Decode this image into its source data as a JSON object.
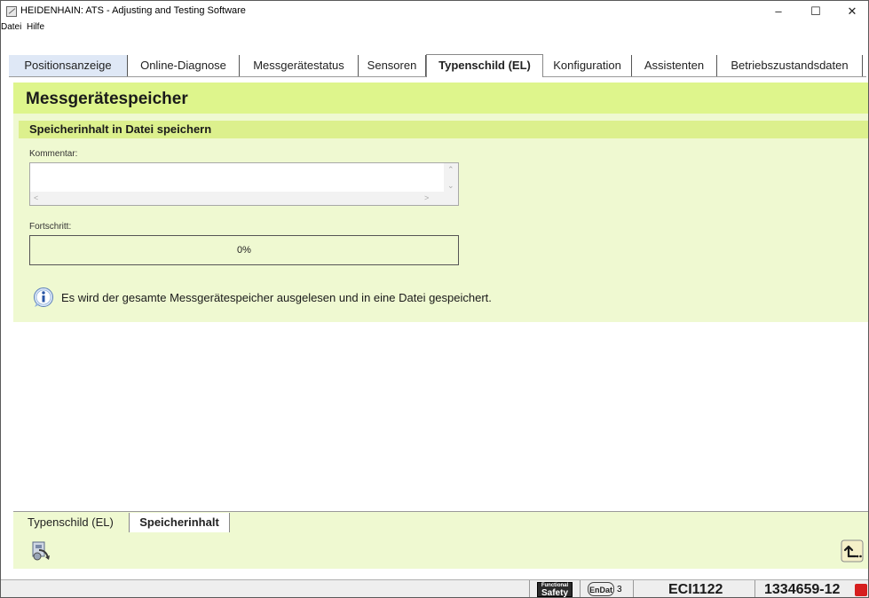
{
  "window": {
    "title": "HEIDENHAIN: ATS - Adjusting and Testing Software",
    "minimize": "–",
    "maximize": "☐",
    "close": "✕"
  },
  "menu": [
    "Datei",
    "Hilfe"
  ],
  "tabs": [
    {
      "label": "Positionsanzeige"
    },
    {
      "label": "Online-Diagnose"
    },
    {
      "label": "Messgerätestatus"
    },
    {
      "label": "Sensoren"
    },
    {
      "label": "Typenschild (EL)"
    },
    {
      "label": "Konfiguration"
    },
    {
      "label": "Assistenten"
    },
    {
      "label": "Betriebszustandsdaten"
    }
  ],
  "active_tab": "Typenschild (EL)",
  "panel": {
    "title": "Messgerätespeicher",
    "section_title": "Speicherinhalt in Datei speichern",
    "comment_label": "Kommentar:",
    "comment_value": "",
    "progress_label": "Fortschritt:",
    "progress_percent": 0,
    "progress_text": "0%",
    "info_text": "Es wird der gesamte Messgerätespeicher ausgelesen und in eine Datei gespeichert."
  },
  "bottom_tabs": [
    {
      "label": "Typenschild (EL)"
    },
    {
      "label": "Speicherinhalt"
    }
  ],
  "active_bottom_tab": "Speicherinhalt",
  "toolbar": {
    "left_tool_icon": "read-memory-to-file-icon",
    "right_tool_icon": "return-arrow-icon"
  },
  "status": {
    "functional_safety_top": "Functional",
    "functional_safety_bottom": "Safety",
    "endat_label": "EnDat",
    "endat_version": "3",
    "device": "ECI1122",
    "id_number": "1334659-12"
  },
  "colors": {
    "panel_header": "#def58c",
    "panel_background": "#eff9d1",
    "progress_fill": "#9bd16b",
    "alert_red": "#d61e1e"
  }
}
